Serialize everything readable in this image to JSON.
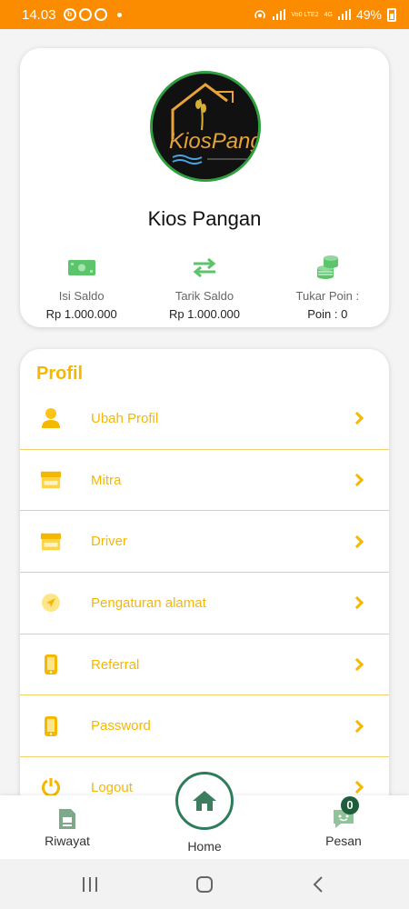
{
  "status_bar": {
    "time": "14.03",
    "battery": "49%",
    "network_labels": [
      "Vo0 LTE2",
      "4G"
    ],
    "notification_icons": [
      "b-icon",
      "whatsapp-icon",
      "whatsapp-icon"
    ]
  },
  "profile": {
    "store_name": "Kios Pangan",
    "logo_text": "KiosPangan",
    "actions": [
      {
        "label": "Isi Saldo",
        "value": "Rp 1.000.000",
        "icon": "money-icon"
      },
      {
        "label": "Tarik Saldo",
        "value": "Rp 1.000.000",
        "icon": "transfer-arrows-icon"
      },
      {
        "label": "Tukar Poin :",
        "value": "Poin : 0",
        "icon": "coins-icon"
      }
    ]
  },
  "menu": {
    "title": "Profil",
    "items": [
      {
        "label": "Ubah Profil",
        "icon": "user-icon"
      },
      {
        "label": "Mitra",
        "icon": "store-icon"
      },
      {
        "label": "Driver",
        "icon": "store-icon"
      },
      {
        "label": "Pengaturan alamat",
        "icon": "location-arrow-icon"
      },
      {
        "label": "Referral",
        "icon": "phone-icon"
      },
      {
        "label": "Password",
        "icon": "phone-icon"
      },
      {
        "label": "Logout",
        "icon": "power-icon"
      }
    ]
  },
  "bottom_nav": {
    "riwayat": "Riwayat",
    "home": "Home",
    "pesan": "Pesan",
    "message_count": "0"
  },
  "colors": {
    "status_bar": "#fb8c00",
    "accent_yellow": "#f5b800",
    "green": "#2e7d5a",
    "icon_green": "#5cc46a"
  }
}
